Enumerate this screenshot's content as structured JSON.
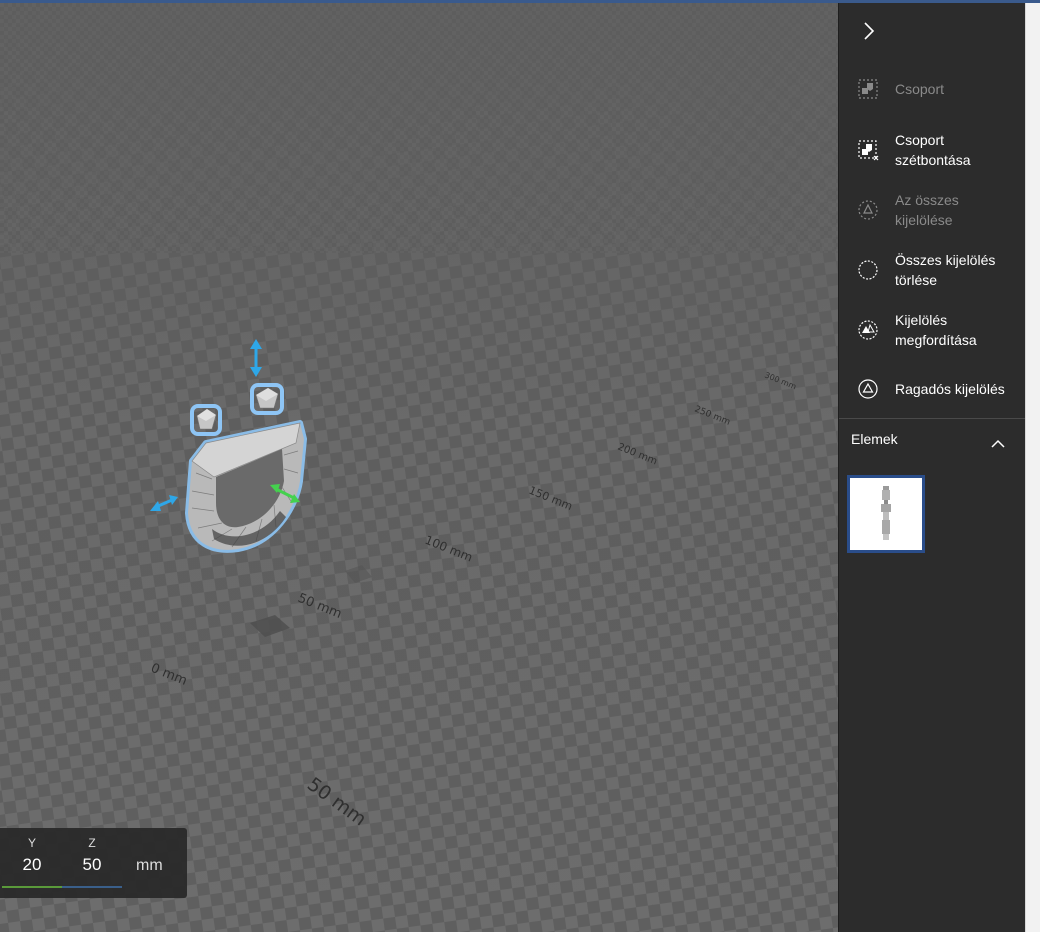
{
  "panel": {
    "commands": [
      {
        "label": "Csoport",
        "icon": "group-icon",
        "enabled": false
      },
      {
        "label": "Csoport szétbontása",
        "icon": "ungroup-icon",
        "enabled": true
      },
      {
        "label": "Az összes kijelölése",
        "icon": "select-all-icon",
        "enabled": false
      },
      {
        "label": "Összes kijelölés törlése",
        "icon": "deselect-all-icon",
        "enabled": true
      },
      {
        "label": "Kijelölés megfordítása",
        "icon": "invert-selection-icon",
        "enabled": true
      },
      {
        "label": "Ragadós kijelölés",
        "icon": "sticky-selection-icon",
        "enabled": true
      }
    ],
    "elements_title": "Elemek",
    "elements": [
      {
        "name": "model-thumbnail"
      }
    ]
  },
  "viewport": {
    "grid_labels": [
      "0 mm",
      "50 mm",
      "100 mm",
      "150 mm",
      "200 mm",
      "250 mm",
      "300 mm",
      "50 mm"
    ]
  },
  "dimensions": {
    "y_label": "Y",
    "y_value": "20",
    "z_label": "Z",
    "z_value": "50",
    "unit": "mm"
  },
  "colors": {
    "accent": "#2a4d8a",
    "selection": "#8ec5f5",
    "arrow_blue": "#2ea7e8",
    "arrow_green": "#44d14e"
  }
}
